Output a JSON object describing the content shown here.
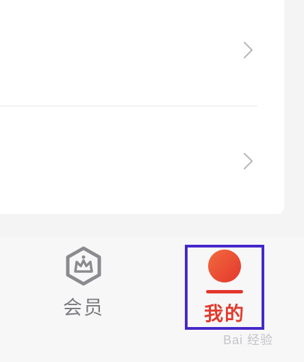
{
  "tabs": [
    {
      "label": "会员",
      "icon": "vip-crown-hexagon-icon",
      "color": "#7b7b7f",
      "selected": false
    },
    {
      "label": "我的",
      "icon": "profile-avatar-icon",
      "color": "#e03b2d",
      "selected": true
    }
  ],
  "watermark": {
    "text": "Bai 经验"
  },
  "colors": {
    "accent": "#e03b2d",
    "highlight_box": "#4527c9",
    "muted_text": "#7b7b7f"
  }
}
